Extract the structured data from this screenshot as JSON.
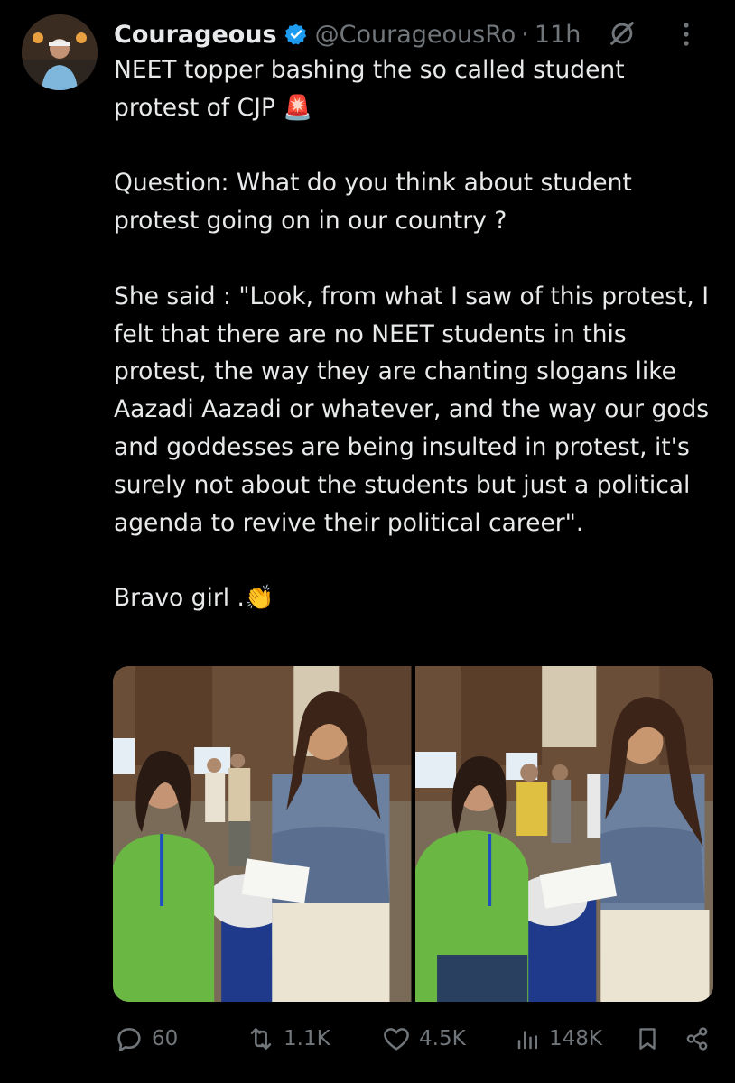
{
  "tweet": {
    "author_name": "Courageous",
    "handle": "@CourageousRo",
    "separator": "·",
    "time": "11h",
    "text": {
      "line1": "NEET topper bashing the so called student protest of CJP",
      "line1_emoji": "🚨",
      "question": "Question: What do you think about student protest going on in our country ?",
      "quote": "She said : \"Look, from what I saw of this protest, I felt that there are no NEET students in this protest, the way they are chanting slogans like Aazadi Aazadi or whatever, and the way our gods and goddesses are being insulted in protest, it's surely not about the students but just a political agenda to revive their political career\".",
      "closing": "Bravo girl .",
      "closing_emoji": "👏"
    }
  },
  "actions": {
    "replies": "60",
    "reposts": "1.1K",
    "likes": "4.5K",
    "views": "148K"
  },
  "icons": {
    "verified": "verified-badge-icon",
    "grok": "grok-icon",
    "more": "more-icon",
    "reply": "reply-icon",
    "retweet": "retweet-icon",
    "like": "heart-icon",
    "views": "views-icon",
    "bookmark": "bookmark-icon",
    "share": "share-icon"
  },
  "colors": {
    "background": "#000000",
    "text": "#e7e9ea",
    "muted": "#71767b",
    "verified": "#1d9bf0"
  }
}
